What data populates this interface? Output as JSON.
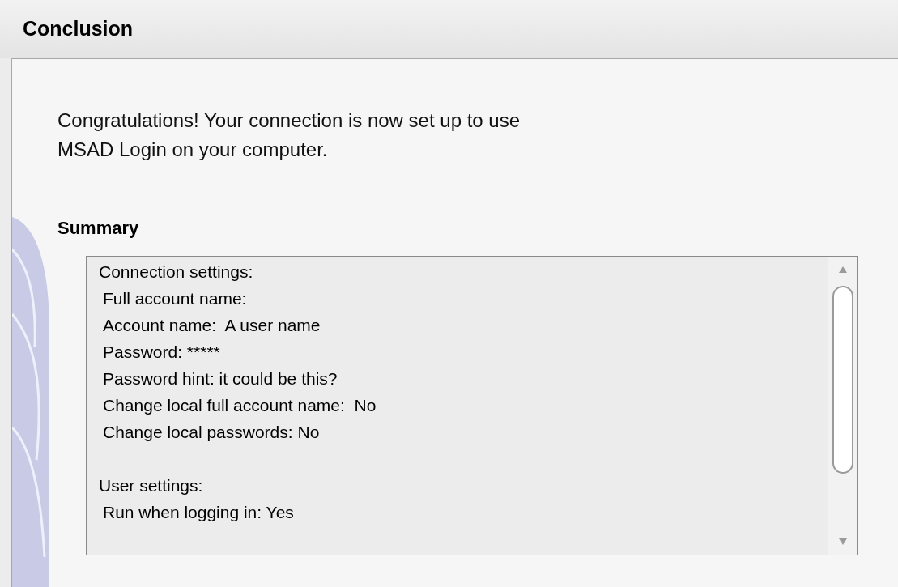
{
  "title": "Conclusion",
  "message": "Congratulations! Your connection is now set up to use MSAD Login on your computer.",
  "summary": {
    "heading": "Summary",
    "groups": [
      {
        "heading": "Connection settings:",
        "lines": [
          "Full account name:",
          "Account name:  A user name",
          "Password: *****",
          "Password hint: it could be this?",
          "Change local full account name:  No",
          "Change local passwords: No"
        ]
      },
      {
        "heading": "User settings:",
        "lines": [
          "Run when logging in: Yes"
        ]
      }
    ]
  }
}
